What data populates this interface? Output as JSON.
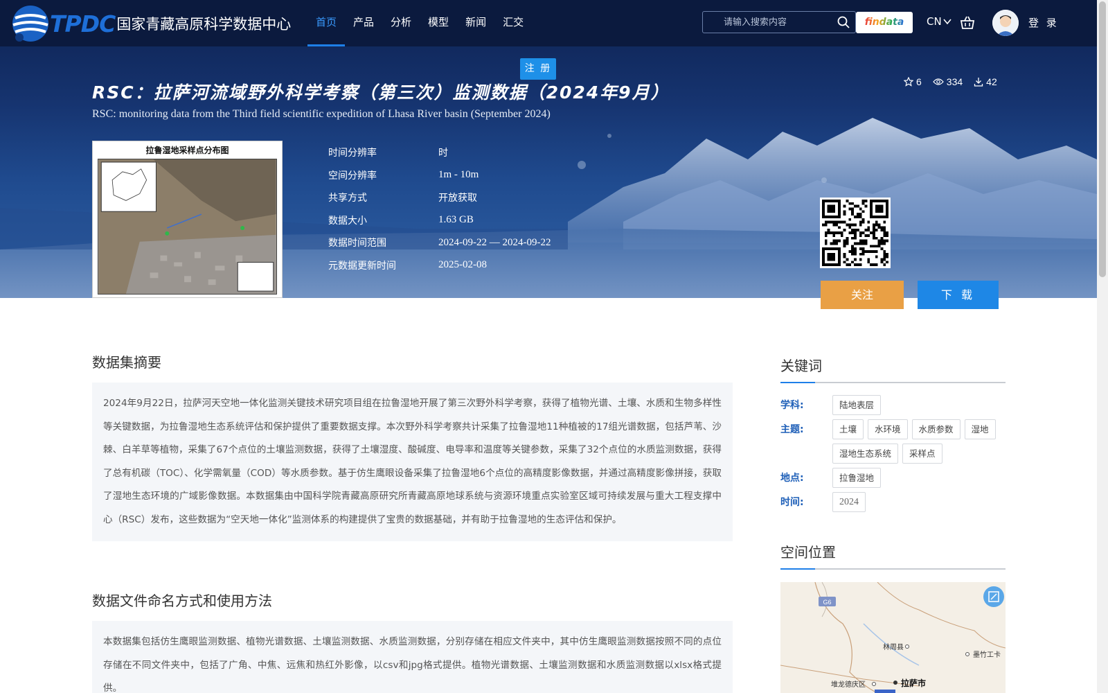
{
  "nav": {
    "logo_tpdc": "TPDC",
    "logo_cn": "国家青藏高原科学数据中心",
    "menu": [
      "首页",
      "产品",
      "分析",
      "模型",
      "新闻",
      "汇交"
    ],
    "search_placeholder": "请输入搜索内容",
    "findata": "findata",
    "lang": "CN",
    "login": "登 录",
    "register": "注 册"
  },
  "dataset": {
    "title_cn": "RSC：拉萨河流域野外科学考察（第三次）监测数据（2024年9月）",
    "title_en": "RSC: monitoring data from the Third field scientific expedition of Lhasa River basin (September 2024)",
    "stats": {
      "favorites": "6",
      "views": "334",
      "downloads": "42"
    },
    "thumbnail_title": "拉鲁湿地采样点分布图",
    "meta": [
      {
        "key": "时间分辨率",
        "value": "时",
        "cn": true
      },
      {
        "key": "空间分辨率",
        "value": "1m - 10m",
        "cn": false
      },
      {
        "key": "共享方式",
        "value": "开放获取",
        "cn": true
      },
      {
        "key": "数据大小",
        "value": "1.63 GB",
        "cn": false
      },
      {
        "key": "数据时间范围",
        "value": "2024-09-22 — 2024-09-22",
        "cn": false
      },
      {
        "key": "元数据更新时间",
        "value": "2025-02-08",
        "cn": false
      }
    ],
    "follow_label": "关注",
    "download_label": "下 载"
  },
  "abstract": {
    "title": "数据集摘要",
    "text": "2024年9月22日，拉萨河天空地一体化监测关键技术研究项目组在拉鲁湿地开展了第三次野外科学考察，获得了植物光谱、土壤、水质和生物多样性等关键数据，为拉鲁湿地生态系统评估和保护提供了重要数据支撑。本次野外科学考察共计采集了拉鲁湿地11种植被的17组光谱数据，包括芦苇、沙棘、白羊草等植物，采集了67个点位的土壤监测数据，获得了土壤湿度、酸碱度、电导率和温度等关键参数，采集了32个点位的水质监测数据，获得了总有机碳（TOC）、化学需氧量（COD）等水质参数。基于仿生鹰眼设备采集了拉鲁湿地6个点位的高精度影像数据，并通过高精度影像拼接，获取了湿地生态环境的广域影像数据。本数据集由中国科学院青藏高原研究所青藏高原地球系统与资源环境重点实验室区域可持续发展与重大工程支撑中心（RSC）发布，这些数据为“空天地一体化”监测体系的构建提供了宝贵的数据基础，并有助于拉鲁湿地的生态评估和保护。"
  },
  "naming": {
    "title": "数据文件命名方式和使用方法",
    "text": "本数据集包括仿生鹰眼监测数据、植物光谱数据、土壤监测数据、水质监测数据，分别存储在相应文件夹中，其中仿生鹰眼监测数据按照不同的点位存储在不同文件夹中，包括了广角、中焦、远焦和热红外影像，以csv和jpg格式提供。植物光谱数据、土壤监测数据和水质监测数据以xlsx格式提供。"
  },
  "keywords": {
    "title": "关键词",
    "groups": [
      {
        "label": "学科:",
        "tags": [
          "陆地表层"
        ]
      },
      {
        "label": "主题:",
        "tags": [
          "土壤",
          "水环境",
          "水质参数",
          "湿地",
          "湿地生态系统",
          "采样点"
        ]
      },
      {
        "label": "地点:",
        "tags": [
          "拉鲁湿地"
        ]
      },
      {
        "label": "时间:",
        "tags": [
          "2024"
        ]
      }
    ]
  },
  "location": {
    "title": "空间位置",
    "map_labels": {
      "highway": "G6",
      "town1": "林周县",
      "town2": "墨竹工卡",
      "district": "堆龙德庆区",
      "city": "拉萨市"
    }
  },
  "colors": {
    "accent": "#1e87e6",
    "follow": "#e9a045",
    "nav_bg": "#0b1a3e"
  }
}
